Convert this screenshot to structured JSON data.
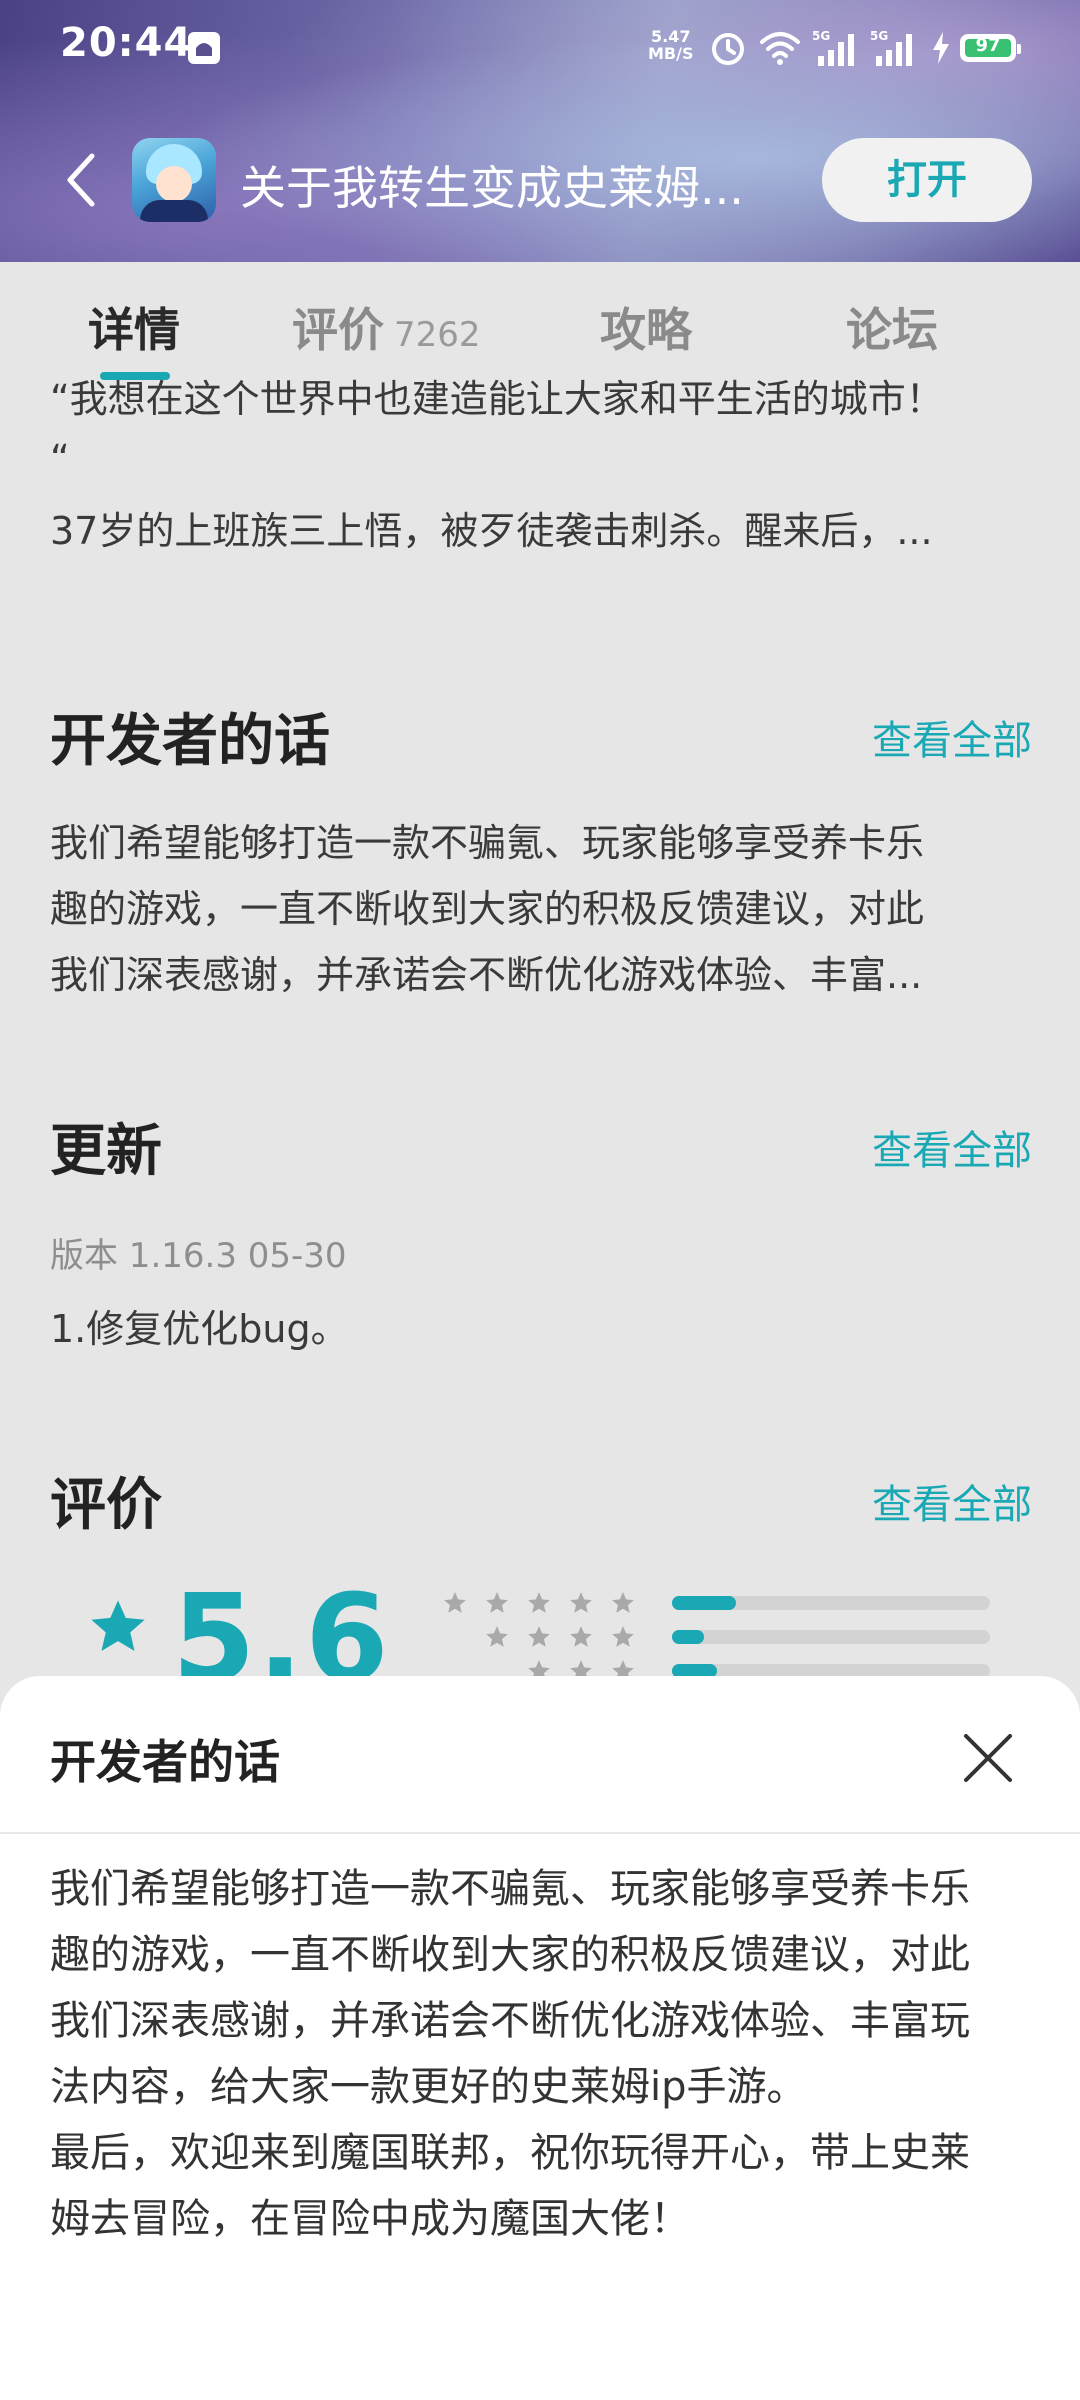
{
  "status_bar": {
    "time": "20:44",
    "net_speed_value": "5.47",
    "net_speed_unit": "MB/S",
    "battery": "97"
  },
  "header": {
    "back_icon": "chevron-left-icon",
    "app_title": "关于我转生变成史莱姆...",
    "open_label": "打开"
  },
  "tabs": [
    {
      "label": "详情",
      "count": ""
    },
    {
      "label": "评价",
      "count": "7262"
    },
    {
      "label": "攻略",
      "count": ""
    },
    {
      "label": "论坛",
      "count": ""
    }
  ],
  "intro": {
    "line1": "“我想在这个世界中也建造能让大家和平生活的城市！",
    "line2": "“",
    "line3": "37岁的上班族三上悟，被歹徒袭击刺杀。醒来后，..."
  },
  "dev_section": {
    "title": "开发者的话",
    "see_all": "查看全部",
    "line1": "我们希望能够打造一款不骗氪、玩家能够享受养卡乐",
    "line2": "趣的游戏，一直不断收到大家的积极反馈建议，对此",
    "line3": "我们深表感谢，并承诺会不断优化游戏体验、丰富..."
  },
  "update_section": {
    "title": "更新",
    "see_all": "查看全部",
    "version": "版本 1.16.3   05-30",
    "notes": "1.修复优化bug。"
  },
  "rating_section": {
    "title": "评价",
    "see_all": "查看全部",
    "score": "5.6",
    "distribution": [
      {
        "stars": 5,
        "fraction": 0.2
      },
      {
        "stars": 4,
        "fraction": 0.1
      },
      {
        "stars": 3,
        "fraction": 0.14
      }
    ]
  },
  "sheet": {
    "title": "开发者的话",
    "close_icon": "close-icon",
    "lines": [
      "我们希望能够打造一款不骗氪、玩家能够享受养卡乐",
      "趣的游戏，一直不断收到大家的积极反馈建议，对此",
      "我们深表感谢，并承诺会不断优化游戏体验、丰富玩",
      "法内容，给大家一款更好的史莱姆ip手游。",
      "最后，欢迎来到魔国联邦，祝你玩得开心，带上史莱",
      "姆去冒险，在冒险中成为魔国大佬！"
    ]
  },
  "colors": {
    "accent": "#1aa9b4",
    "background": "#e6e6e6",
    "battery_green": "#38c172"
  }
}
